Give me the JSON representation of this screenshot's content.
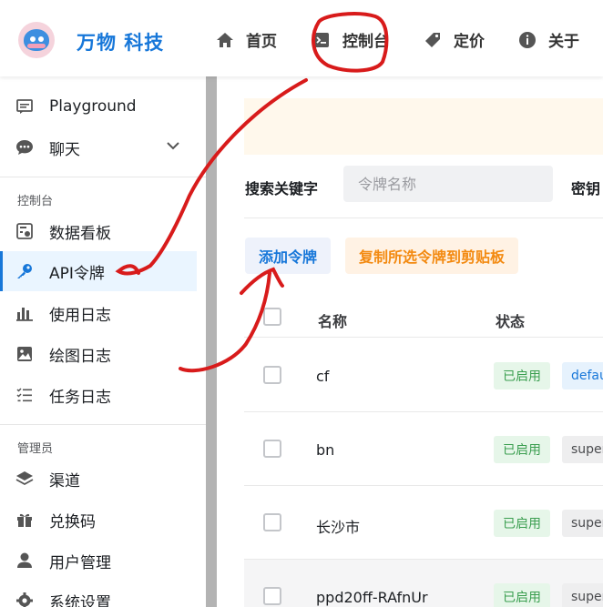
{
  "header": {
    "brand": "万物 科技",
    "nav": [
      {
        "label": "首页",
        "icon": "home-icon"
      },
      {
        "label": "控制台",
        "icon": "terminal-icon"
      },
      {
        "label": "定价",
        "icon": "price-tag-icon"
      },
      {
        "label": "关于",
        "icon": "info-icon"
      }
    ]
  },
  "sidebar": {
    "top_items": [
      {
        "label": "Playground",
        "icon": "playground-icon"
      },
      {
        "label": "聊天",
        "icon": "chat-icon"
      }
    ],
    "console_section": "控制台",
    "console_items": [
      {
        "label": "数据看板",
        "icon": "dashboard-icon"
      },
      {
        "label": "API令牌",
        "icon": "key-icon"
      },
      {
        "label": "使用日志",
        "icon": "bar-chart-icon"
      },
      {
        "label": "绘图日志",
        "icon": "image-icon"
      },
      {
        "label": "任务日志",
        "icon": "checklist-icon"
      }
    ],
    "admin_section": "管理员",
    "admin_items": [
      {
        "label": "渠道",
        "icon": "layers-icon"
      },
      {
        "label": "兑换码",
        "icon": "gift-icon"
      },
      {
        "label": "用户管理",
        "icon": "user-icon"
      },
      {
        "label": "系统设置",
        "icon": "settings-icon"
      }
    ]
  },
  "main": {
    "search_label": "搜索关键字",
    "search_placeholder": "令牌名称",
    "key_label": "密钥",
    "add_button": "添加令牌",
    "copy_button": "复制所选令牌到剪贴板",
    "columns": {
      "name": "名称",
      "status": "状态"
    },
    "rows": [
      {
        "name": "cf",
        "status": "已启用",
        "group": "default"
      },
      {
        "name": "bn",
        "status": "已启用",
        "group": "super"
      },
      {
        "name": "长沙市",
        "status": "已启用",
        "group": "super"
      },
      {
        "name": "ppd20ff-RAfnUr",
        "status": "已启用",
        "group": "super"
      }
    ]
  },
  "colors": {
    "accent": "#1777d9",
    "active_bg": "#eaf5ff",
    "status_green": "#3a9e4f",
    "copy_orange": "#f38a11",
    "annotation_red": "#d81b1b"
  }
}
